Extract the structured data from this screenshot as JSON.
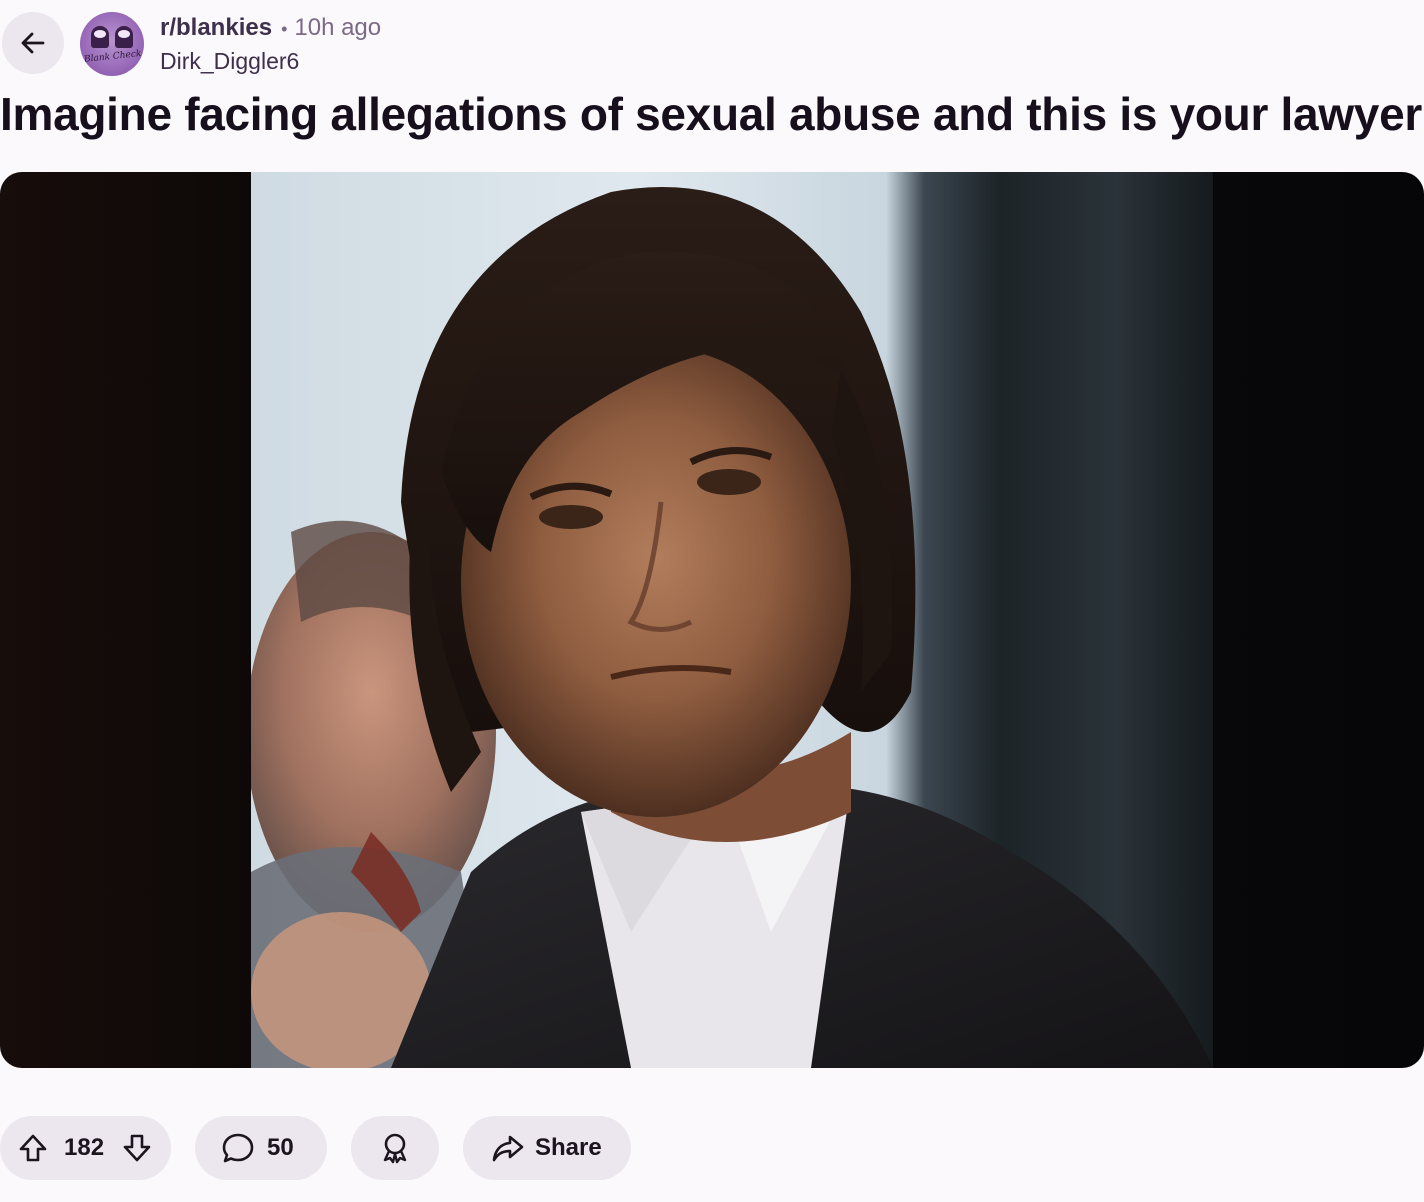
{
  "post": {
    "subreddit": "r/blankies",
    "separator": "•",
    "time_ago": "10h ago",
    "author": "Dirk_Diggler6",
    "title": "Imagine facing allegations of sexual abuse and this is your lawyer",
    "subreddit_icon_text": "Blank Check"
  },
  "media": {
    "kind": "image",
    "description_icon": "photo"
  },
  "actions": {
    "upvotes": "182",
    "comments": "50",
    "share_label": "Share"
  },
  "colors": {
    "background": "#fbf9fc",
    "pill": "#ece6ee",
    "text": "#1c1520",
    "muted": "#7b6a86",
    "avatar": "#9b6dbb"
  },
  "icons": {
    "back": "arrow-left-icon",
    "upvote": "arrow-up-icon",
    "downvote": "arrow-down-icon",
    "comment": "speech-bubble-icon",
    "award": "award-ribbon-icon",
    "share": "share-arrow-icon"
  }
}
